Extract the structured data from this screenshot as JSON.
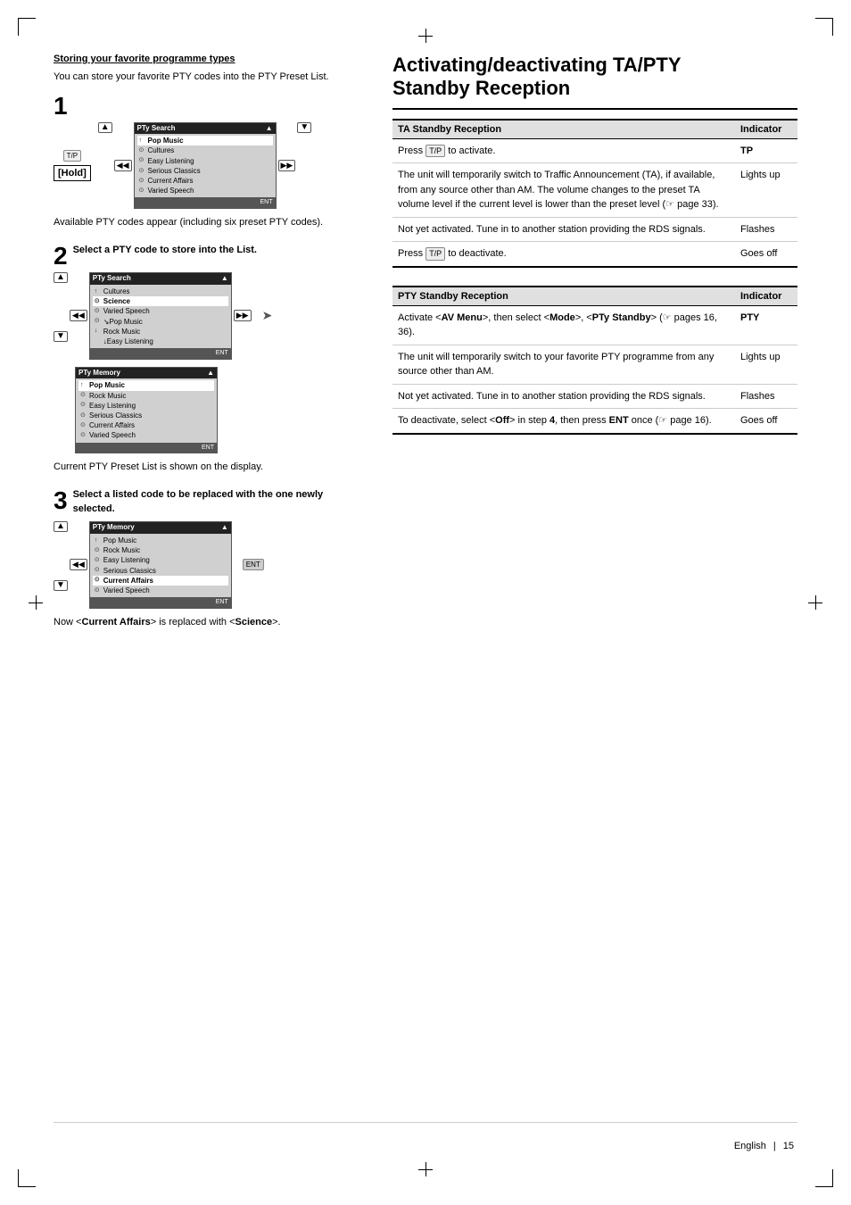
{
  "page": {
    "number": "15",
    "language": "English"
  },
  "left_section": {
    "title": "Storing your favorite programme types",
    "description": "You can store your favorite PTY codes into the PTY Preset List.",
    "steps": [
      {
        "number": "1",
        "text": "",
        "note": "Available PTY codes appear (including six preset PTY codes).",
        "screen1": {
          "header": "PTy Search",
          "rows": [
            {
              "icon": "▲",
              "text": "↑Pop Music",
              "selected": true
            },
            {
              "icon": "⊙",
              "text": "Cultures",
              "selected": false
            },
            {
              "icon": "◁◁",
              "text": "⊙ Easy Listening",
              "selected": false
            },
            {
              "icon": "⊙",
              "text": "Serious Classics",
              "selected": false
            },
            {
              "icon": "⊙",
              "text": "Current Affairs",
              "selected": false
            },
            {
              "icon": "⊙",
              "text": "Varied Speech",
              "selected": false
            }
          ],
          "footer": "ENT"
        }
      },
      {
        "number": "2",
        "text": "Select a PTY code to store into the List.",
        "note": "Current PTY Preset List is shown on the display.",
        "screen1": {
          "header": "PTy Search",
          "rows": [
            {
              "icon": "▲",
              "text": "↑Cultures",
              "selected": false
            },
            {
              "icon": "⊙",
              "text": "Science",
              "selected": true
            },
            {
              "icon": "◁◁",
              "text": "⊙Varied Speech",
              "selected": false
            },
            {
              "icon": "⊙",
              "text": "↘Pop Music",
              "selected": false
            },
            {
              "icon": "▼",
              "text": "↓Rock Music",
              "selected": false
            },
            {
              "icon": "",
              "text": "↓Easy Listening",
              "selected": false
            }
          ],
          "footer": "ENT"
        },
        "screen2": {
          "header": "PTy Memory",
          "rows": [
            {
              "icon": "▲",
              "text": "↑Pop Music",
              "selected": true
            },
            {
              "icon": "⊙",
              "text": "Rock Music",
              "selected": false
            },
            {
              "icon": "◁◁",
              "text": "⊙ Easy Listening",
              "selected": false
            },
            {
              "icon": "⊙",
              "text": "Serious Classics",
              "selected": false
            },
            {
              "icon": "⊙",
              "text": "Current Affairs",
              "selected": false
            },
            {
              "icon": "⊙",
              "text": "Varied Speech",
              "selected": false
            }
          ],
          "footer": "ENT"
        }
      },
      {
        "number": "3",
        "text": "Select a listed code to be replaced with the one newly selected.",
        "note2_part1": "Now <",
        "note2_bold": "Current Affairs",
        "note2_part2": "> is replaced with\n<",
        "note2_bold2": "Science",
        "note2_part3": ">.",
        "screen1": {
          "header": "PTy Memory",
          "rows": [
            {
              "icon": "▲",
              "text": "↑Pop Music",
              "selected": false
            },
            {
              "icon": "⊙",
              "text": "Rock Music",
              "selected": false
            },
            {
              "icon": "◁◁",
              "text": "⊙ Easy Listening",
              "selected": false
            },
            {
              "icon": "⊙",
              "text": "Serious Classics",
              "selected": false
            },
            {
              "icon": "⊙",
              "text": "Current Affairs",
              "selected": true
            },
            {
              "icon": "⊙",
              "text": "Varied Speech",
              "selected": false
            }
          ],
          "footer": "ENT"
        }
      }
    ]
  },
  "right_section": {
    "title": "Activating/deactivating TA/PTY\nStandby Reception",
    "ta_table": {
      "col1": "TA Standby Reception",
      "col2": "Indicator",
      "rows": [
        {
          "desc": "Press [T/P] to activate.",
          "indicator": "TP",
          "indicator_bold": true
        },
        {
          "desc": "The unit will temporarily switch to Traffic Announcement (TA), if available, from any source other than AM. The volume changes to the preset TA volume level if the current level is lower than the preset level (☞ page 33).",
          "indicator": "Lights up",
          "indicator_bold": false
        },
        {
          "desc": "Not yet activated. Tune in to another station providing the RDS signals.",
          "indicator": "Flashes",
          "indicator_bold": false
        },
        {
          "desc": "Press [T/P] to deactivate.",
          "indicator": "Goes off",
          "indicator_bold": false
        }
      ]
    },
    "pty_table": {
      "col1": "PTY Standby Reception",
      "col2": "Indicator",
      "rows": [
        {
          "desc": "Activate <AV Menu>, then select <Mode>, <PTy Standby> (☞ pages 16, 36).",
          "indicator": "PTY",
          "indicator_bold": true
        },
        {
          "desc": "The unit will temporarily switch to your favorite PTY programme from any source other than AM.",
          "indicator": "Lights up",
          "indicator_bold": false
        },
        {
          "desc": "Not yet activated. Tune in to another station providing the RDS signals.",
          "indicator": "Flashes",
          "indicator_bold": false
        },
        {
          "desc": "To deactivate, select <Off> in step 4, then press ENT once (☞ page 16).",
          "indicator": "Goes off",
          "indicator_bold": false
        }
      ]
    }
  }
}
